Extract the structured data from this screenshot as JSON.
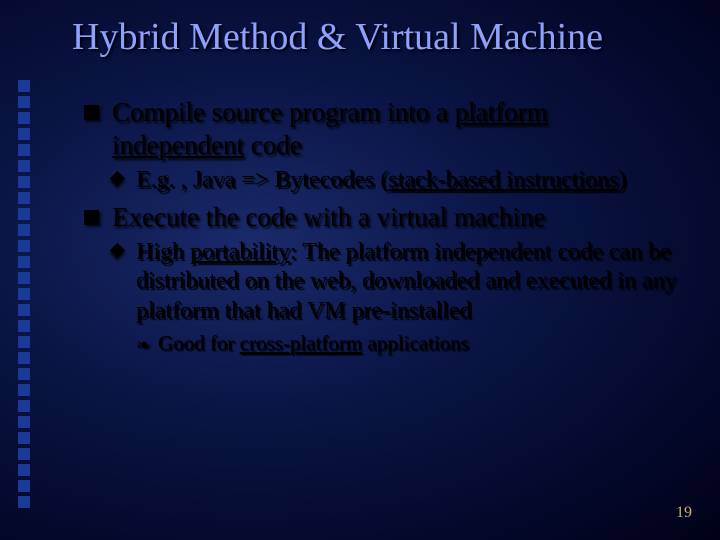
{
  "title": "Hybrid Method & Virtual Machine",
  "items": [
    {
      "pre": "Compile source program into a ",
      "u": "platform independent",
      "post": " code",
      "sub": [
        {
          "pre": "E.g. , Java => Bytecodes (",
          "u": "stack-based instructions",
          "post": ")"
        }
      ]
    },
    {
      "pre": "Execute the code with a virtual machine",
      "u": "",
      "post": "",
      "sub": [
        {
          "pre": "High ",
          "u": "portability",
          "post": ": The platform independent code can be distributed on the web, downloaded and executed in any platform that had VM pre-installed",
          "sub": [
            {
              "pre": "Good for ",
              "u": "cross-platform",
              "post": " applications"
            }
          ]
        }
      ]
    }
  ],
  "page_number": "19"
}
